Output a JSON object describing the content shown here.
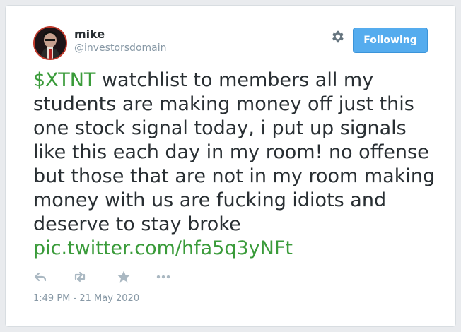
{
  "user": {
    "name": "mike",
    "handle": "@investorsdomain"
  },
  "follow_button": {
    "label": "Following"
  },
  "tweet": {
    "cashtag": "$XTNT",
    "text": " watchlist to members all my students are making money off just this one stock signal today, i put up signals like this each day in my room! no offense but those that are not in my room making money with us are fucking idiots and deserve to stay broke ",
    "link": "pic.twitter.com/hfa5q3yNFt",
    "timestamp": "1:49 PM - 21 May 2020"
  },
  "actions": {
    "reply_icon": "reply-icon",
    "retweet_icon": "retweet-icon",
    "favorite_icon": "star-icon",
    "more_icon": "more-icon"
  },
  "colors": {
    "link": "#3a9b3a",
    "button": "#55acee",
    "muted": "#8899a6",
    "text": "#292f33"
  }
}
